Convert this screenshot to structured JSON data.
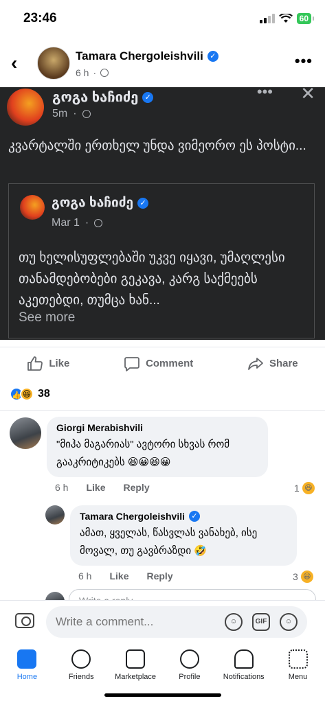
{
  "status_bar": {
    "time": "23:46",
    "battery": "60"
  },
  "header": {
    "name": "Tamara Chergoleishvili",
    "time": "6 h",
    "dot": "·"
  },
  "shared_post": {
    "author": "გოგა ხაჩიძე",
    "time": "5m",
    "dot": "·",
    "text": "კვარტალში ერთხელ უნდა ვიმეორო ეს პოსტი...",
    "inner": {
      "author": "გოგა ხაჩიძე",
      "date": "Mar 1",
      "dot": "·",
      "text": "თუ ხელისუფლებაში უკვე იყავი, უმაღლესი თანამდებობები გეკავა, კარგ საქმეებს აკეთებდი, თუმცა ხან...",
      "see_more": "See more"
    }
  },
  "actions": {
    "like": "Like",
    "comment": "Comment",
    "share": "Share"
  },
  "reactions": {
    "count": "38"
  },
  "comments": [
    {
      "name": "Giorgi Merabishvili",
      "text": "\"მიჰა მაგარიას\" ავტორი სხვას რომ გააკრიტიკებს 😆😀😆😀",
      "time": "6 h",
      "like": "Like",
      "reply": "Reply",
      "react_count": "1"
    },
    {
      "name": "Tamara Chergoleishvili",
      "text": "ამათ, ყველას, წასვლას ვანახებ, ისე მოვალ, თუ გავბრაზდი 🤣",
      "time": "6 h",
      "like": "Like",
      "reply": "Reply",
      "react_count": "3"
    }
  ],
  "reply_placeholder": "Write a reply...",
  "composer": {
    "placeholder": "Write a comment...",
    "gif": "GIF"
  },
  "nav": [
    {
      "label": "Home"
    },
    {
      "label": "Friends"
    },
    {
      "label": "Marketplace"
    },
    {
      "label": "Profile"
    },
    {
      "label": "Notifications"
    },
    {
      "label": "Menu"
    }
  ],
  "colors": {
    "accent": "#1877f2",
    "dark_card": "#242526"
  }
}
